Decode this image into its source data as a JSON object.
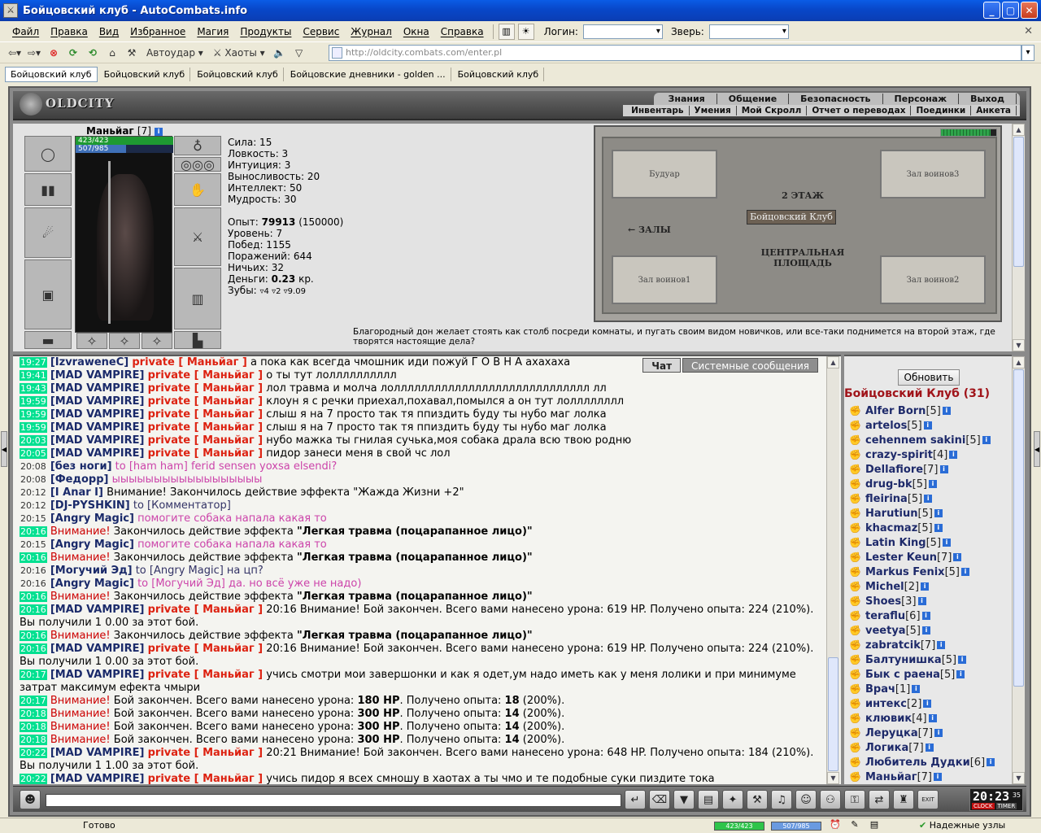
{
  "window": {
    "title": "Бойцовский клуб - AutoCombats.info",
    "buttons": {
      "minimize": "_",
      "maximize": "▢",
      "close": "✕"
    }
  },
  "menubar": {
    "items": [
      "Файл",
      "Правка",
      "Вид",
      "Избранное",
      "Магия",
      "Продукты",
      "Сервис",
      "Журнал",
      "Окна",
      "Справка"
    ],
    "login_label": "Логин:",
    "beast_label": "Зверь:"
  },
  "toolbar": {
    "autoudar": "Автоудар",
    "haoty": "Хаоты",
    "address": "http://oldcity.combats.com/enter.pl"
  },
  "tabs": [
    "Бойцовский клуб",
    "Бойцовский клуб",
    "Бойцовский клуб",
    "Бойцовские дневники - golden ...",
    "Бойцовский клуб"
  ],
  "game": {
    "logo": "OLDCITY",
    "nav_top": [
      "Знания",
      "Общение",
      "Безопасность",
      "Персонаж",
      "Выход"
    ],
    "nav_bottom": [
      "Инвентарь",
      "Умения",
      "Мой Скролл",
      "Отчет о переводах",
      "Поединки",
      "Анкета"
    ]
  },
  "character": {
    "name": "Маньйаг",
    "level": "[7]",
    "hp": "423/423",
    "mp": "507/985",
    "hp_fraction": 1.0,
    "mp_fraction": 0.515,
    "stats": [
      "Сила: 15",
      "Ловкость: 3",
      "Интуиция: 3",
      "Выносливость: 20",
      "Интеллект: 50",
      "Мудрость: 30"
    ],
    "exp_label": "Опыт: ",
    "exp_value": "79913",
    "exp_next": " (150000)",
    "level_line": "Уровень: 7",
    "wins": "Побед: 1155",
    "losses": "Поражений: 644",
    "draws": "Ничьих: 32",
    "money_label": "Деньги: ",
    "money_value": "0.23",
    "money_unit": " кр.",
    "teeth_label": "Зубы: ",
    "teeth_value": "▿4 ▿2 ▿9.09"
  },
  "map": {
    "floor": "2 ЭТАЖ",
    "halls_label": "← ЗАЛЫ",
    "boudoir": "Будуар",
    "hall3": "Зал воинов3",
    "hall1": "Зал воинов1",
    "hall2": "Зал воинов2",
    "club": "Бойцовский Клуб",
    "square": "ЦЕНТРАЛЬНАЯ ПЛОЩАДЬ",
    "description": "Благородный дон желает стоять как столб посреди комнаты, и пугать своим видом новичков, или все-таки поднимется на второй этаж, где творятся настоящие дела?"
  },
  "chat": {
    "tabs": {
      "chat": "Чат",
      "system": "Системные сообщения"
    },
    "messages": [
      {
        "time": "19:27",
        "hl": true,
        "nick": "[IzvraweneC]",
        "priv": "private [ Маньйаг ]",
        "text": " а пока как всегда чмошник иди пожуй  Г О В Н А ахахаха"
      },
      {
        "time": "19:41",
        "hl": true,
        "nick": "[MAD VAMPIRE]",
        "priv": "private [ Маньйаг ]",
        "text": " о ты тут лолллллллллл"
      },
      {
        "time": "19:43",
        "hl": true,
        "nick": "[MAD VAMPIRE]",
        "priv": "private [ Маньйаг ]",
        "text": " лол травма и молча лоллллллллллллллллллллллллллллл лл"
      },
      {
        "time": "19:59",
        "hl": true,
        "nick": "[MAD VAMPIRE]",
        "priv": "private [ Маньйаг ]",
        "text": " клоун я с речки приехал,похавал,помылся а он тут лолллллллл"
      },
      {
        "time": "19:59",
        "hl": true,
        "nick": "[MAD VAMPIRE]",
        "priv": "private [ Маньйаг ]",
        "text": " слыш я на 7 просто так тя ппиздить буду ты нубо маг лолка"
      },
      {
        "time": "19:59",
        "hl": true,
        "nick": "[MAD VAMPIRE]",
        "priv": "private [ Маньйаг ]",
        "text": " слыш я на 7 просто так тя ппиздить буду ты нубо маг лолка"
      },
      {
        "time": "20:03",
        "hl": true,
        "nick": "[MAD VAMPIRE]",
        "priv": "private [ Маньйаг ]",
        "text": " нубо мажка ты гнилая сучька,моя собака драла всю твою родню"
      },
      {
        "time": "20:05",
        "hl": true,
        "nick": "[MAD VAMPIRE]",
        "priv": "private [ Маньйаг ]",
        "text": " пидор занеси меня в свой чс лол"
      },
      {
        "time": "20:08",
        "hl": false,
        "nick": "[без ноги]",
        "to": " to [ham ham] ferid sensen yoxsa elsendi?"
      },
      {
        "time": "20:08",
        "hl": false,
        "nick": "[Федорр]",
        "note": " ыыыыыыыыыыыыыыыыыы"
      },
      {
        "time": "20:12",
        "hl": false,
        "nick": "[I Anar I]",
        "text": " Внимание! Закончилось действие эффекта \"Жажда Жизни +2\""
      },
      {
        "time": "20:12",
        "hl": false,
        "nick": "[DJ-PYSHKIN]",
        "toblue": " to [Комментатор]"
      },
      {
        "time": "20:15",
        "hl": false,
        "nick": "[Angry Magic]",
        "to": " помогите собака напала какая то"
      },
      {
        "time": "20:16",
        "hl": true,
        "warn": "Внимание!",
        "text": " Закончилось действие эффекта ",
        "bold": "\"Легкая травма (поцарапанное лицо)\""
      },
      {
        "time": "20:15",
        "hl": false,
        "nick": "[Angry Magic]",
        "to": " помогите собака напала какая то"
      },
      {
        "time": "20:16",
        "hl": true,
        "warn": "Внимание!",
        "text": " Закончилось действие эффекта ",
        "bold": "\"Легкая травма (поцарапанное лицо)\""
      },
      {
        "time": "20:16",
        "hl": false,
        "nick": "[Могучий Эд]",
        "toblue": " to [Angry Magic] на цп?"
      },
      {
        "time": "20:16",
        "hl": false,
        "nick": "[Angry Magic]",
        "to": " to [Могучий Эд] да. но всё уже не надо)"
      },
      {
        "time": "20:16",
        "hl": true,
        "warn": "Внимание!",
        "text": " Закончилось действие эффекта ",
        "bold": "\"Легкая травма (поцарапанное лицо)\""
      },
      {
        "time": "20:16",
        "hl": true,
        "nick": "[MAD VAMPIRE]",
        "priv": "private [ Маньйаг ]",
        "text": " 20:16 Внимание! Бой закончен. Всего вами нанесено урона: 619 HP. Получено опыта: 224 (210%). Вы получили 1 0.00 за этот бой.",
        "wrap": true
      },
      {
        "time": "20:16",
        "hl": true,
        "warn": "Внимание!",
        "text": " Закончилось действие эффекта ",
        "bold": "\"Легкая травма (поцарапанное лицо)\""
      },
      {
        "time": "20:16",
        "hl": true,
        "nick": "[MAD VAMPIRE]",
        "priv": "private [ Маньйаг ]",
        "text": " 20:16 Внимание! Бой закончен. Всего вами нанесено урона: 619 HP. Получено опыта: 224 (210%). Вы получили 1 0.00 за этот бой.",
        "wrap": true
      },
      {
        "time": "20:17",
        "hl": true,
        "nick": "[MAD VAMPIRE]",
        "priv": "private [ Маньйаг ]",
        "text": " учись смотри мои завершонки и как я одет,ум надо иметь как у меня лолики и при минимуме затрат максимум ефекта чмыри",
        "wrap": true
      },
      {
        "time": "20:17",
        "hl": true,
        "warn": "Внимание!",
        "text": " Бой закончен. Всего вами нанесено урона: ",
        "bold": "180 HP",
        "text2": ". Получено опыта: ",
        "bold2": "18",
        "text3": " (200%)."
      },
      {
        "time": "20:18",
        "hl": true,
        "warn": "Внимание!",
        "text": " Бой закончен. Всего вами нанесено урона: ",
        "bold": "300 HP",
        "text2": ". Получено опыта: ",
        "bold2": "14",
        "text3": " (200%)."
      },
      {
        "time": "20:18",
        "hl": true,
        "warn": "Внимание!",
        "text": " Бой закончен. Всего вами нанесено урона: ",
        "bold": "300 HP",
        "text2": ". Получено опыта: ",
        "bold2": "14",
        "text3": " (200%)."
      },
      {
        "time": "20:18",
        "hl": true,
        "warn": "Внимание!",
        "text": " Бой закончен. Всего вами нанесено урона: ",
        "bold": "300 HP",
        "text2": ". Получено опыта: ",
        "bold2": "14",
        "text3": " (200%)."
      },
      {
        "time": "20:22",
        "hl": true,
        "nick": "[MAD VAMPIRE]",
        "priv": "private [ Маньйаг ]",
        "text": " 20:21 Внимание! Бой закончен. Всего вами нанесено урона: 648 HP. Получено опыта: 184 (210%). Вы получили 1 1.00 за этот бой.",
        "wrap": true
      },
      {
        "time": "20:22",
        "hl": true,
        "nick": "[MAD VAMPIRE]",
        "priv": "private [ Маньйаг ]",
        "text": " учись пидор я всех смношу в хаотах а ты чмо и те подобные суки пиздите тока"
      }
    ]
  },
  "online": {
    "refresh": "Обновить",
    "room": "Бойцовский Клуб (31)",
    "users": [
      {
        "name": "Alfer Born",
        "lvl": "[5]"
      },
      {
        "name": "artelos",
        "lvl": "[5]"
      },
      {
        "name": "cehennem sakini",
        "lvl": "[5]"
      },
      {
        "name": "crazy-spirit",
        "lvl": "[4]"
      },
      {
        "name": "Dellafiore",
        "lvl": "[7]"
      },
      {
        "name": "drug-bk",
        "lvl": "[5]"
      },
      {
        "name": "fleirina",
        "lvl": "[5]"
      },
      {
        "name": "Harutiun",
        "lvl": "[5]"
      },
      {
        "name": "khacmaz",
        "lvl": "[5]"
      },
      {
        "name": "Latin King",
        "lvl": "[5]"
      },
      {
        "name": "Lester Keun",
        "lvl": "[7]"
      },
      {
        "name": "Markus Fenix",
        "lvl": "[5]"
      },
      {
        "name": "Michel",
        "lvl": "[2]"
      },
      {
        "name": "Shoes",
        "lvl": "[3]"
      },
      {
        "name": "teraflu",
        "lvl": "[6]"
      },
      {
        "name": "veetya",
        "lvl": "[5]"
      },
      {
        "name": "zabratcik",
        "lvl": "[7]"
      },
      {
        "name": "Балтунишка",
        "lvl": "[5]"
      },
      {
        "name": "Бык с раена",
        "lvl": "[5]"
      },
      {
        "name": "Врач",
        "lvl": "[1]"
      },
      {
        "name": "интекс",
        "lvl": "[2]"
      },
      {
        "name": "клювик",
        "lvl": "[4]"
      },
      {
        "name": "Леруцка",
        "lvl": "[7]"
      },
      {
        "name": "Логика",
        "lvl": "[7]"
      },
      {
        "name": "Любитель Дудки",
        "lvl": "[6]"
      },
      {
        "name": "Маньйаг",
        "lvl": "[7]"
      }
    ]
  },
  "bottom": {
    "clock_time": "20:23",
    "clock_sec": "35",
    "clock_label": "CLOCK",
    "timer_label": "TIMER",
    "exit_label": "EXIT"
  },
  "statusbar": {
    "ready": "Готово",
    "hp": "423/423",
    "mp": "507/985",
    "nodes": "Надежные узлы"
  },
  "icons": {
    "info": "i",
    "user_status": "fist-icon"
  }
}
